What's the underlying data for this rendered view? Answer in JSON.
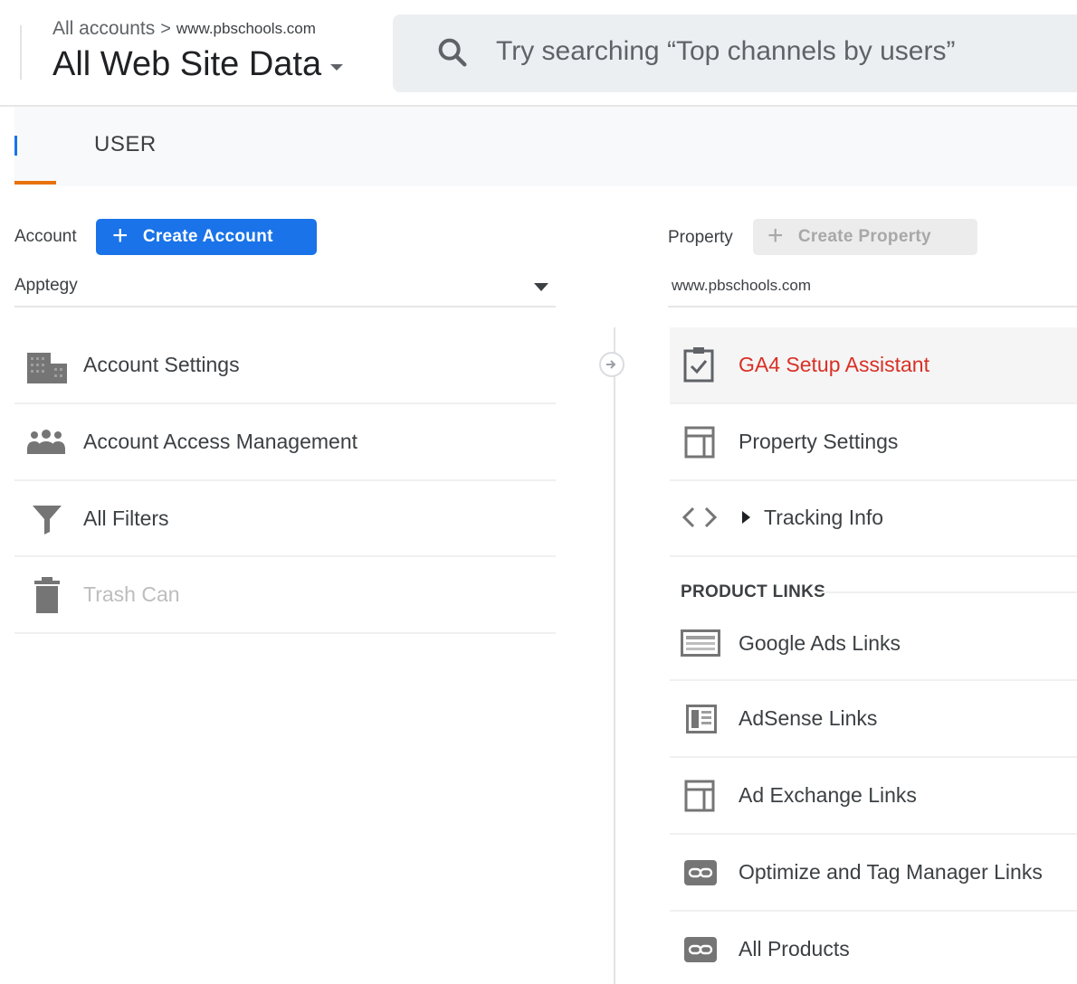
{
  "header": {
    "breadcrumb_root": "All accounts",
    "breadcrumb_separator": ">",
    "breadcrumb_property": "www.pbschools.com",
    "view_title": "All Web Site Data",
    "search_placeholder": "Try searching “Top channels by users”"
  },
  "tabs": {
    "user": "USER"
  },
  "account": {
    "label": "Account",
    "create_button": "Create Account",
    "selected": "Apptegy",
    "items": [
      {
        "label": "Account Settings",
        "icon": "building-icon"
      },
      {
        "label": "Account Access Management",
        "icon": "people-icon"
      },
      {
        "label": "All Filters",
        "icon": "filter-icon"
      },
      {
        "label": "Trash Can",
        "icon": "trash-icon",
        "disabled": true
      }
    ]
  },
  "property": {
    "label": "Property",
    "create_button": "Create Property",
    "selected": "www.pbschools.com",
    "items": [
      {
        "label": "GA4 Setup Assistant",
        "icon": "clipboard-check-icon",
        "highlight_color": "#d93025"
      },
      {
        "label": "Property Settings",
        "icon": "layout-icon"
      },
      {
        "label": "Tracking Info",
        "icon": "code-icon"
      }
    ],
    "product_links_header": "PRODUCT LINKS",
    "product_links": [
      {
        "label": "Google Ads Links",
        "icon": "ads-icon"
      },
      {
        "label": "AdSense Links",
        "icon": "adsense-icon"
      },
      {
        "label": "Ad Exchange Links",
        "icon": "layout-icon"
      },
      {
        "label": "Optimize and Tag Manager Links",
        "icon": "link-icon"
      },
      {
        "label": "All Products",
        "icon": "link-icon"
      }
    ]
  },
  "colors": {
    "primary": "#1a73e8",
    "accent_tab": "#e8710a",
    "alert_text": "#d93025",
    "disabled_text": "#bdbdbd",
    "icon_gray": "#757575"
  }
}
